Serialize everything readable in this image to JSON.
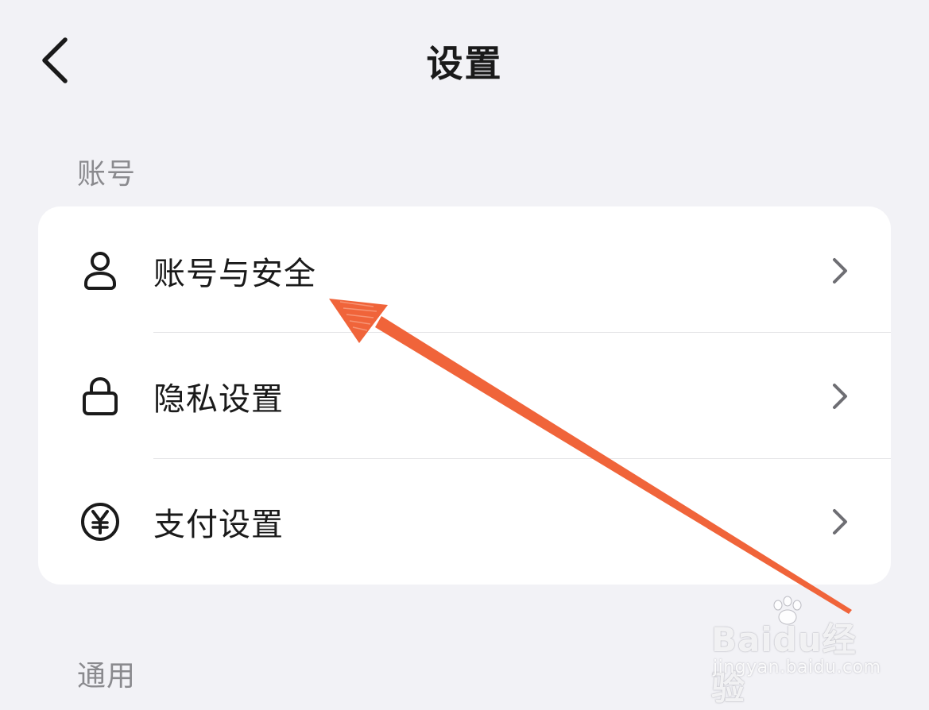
{
  "header": {
    "title": "设置",
    "back_icon": "chevron-left-icon"
  },
  "sections": [
    {
      "label": "账号",
      "items": [
        {
          "label": "账号与安全",
          "icon": "person-icon"
        },
        {
          "label": "隐私设置",
          "icon": "lock-icon"
        },
        {
          "label": "支付设置",
          "icon": "yen-circle-icon"
        }
      ]
    },
    {
      "label": "通用"
    }
  ],
  "annotation": {
    "type": "arrow",
    "color": "#f0643a",
    "points_to": "账号与安全"
  },
  "watermark": {
    "logo": "Baidu经验",
    "url": "jingyan.baidu.com"
  },
  "colors": {
    "background": "#f2f2f6",
    "card": "#ffffff",
    "section_label": "#8a8a8e",
    "text": "#1a1a1a",
    "chevron": "#6e6e73",
    "arrow": "#f0643a"
  }
}
